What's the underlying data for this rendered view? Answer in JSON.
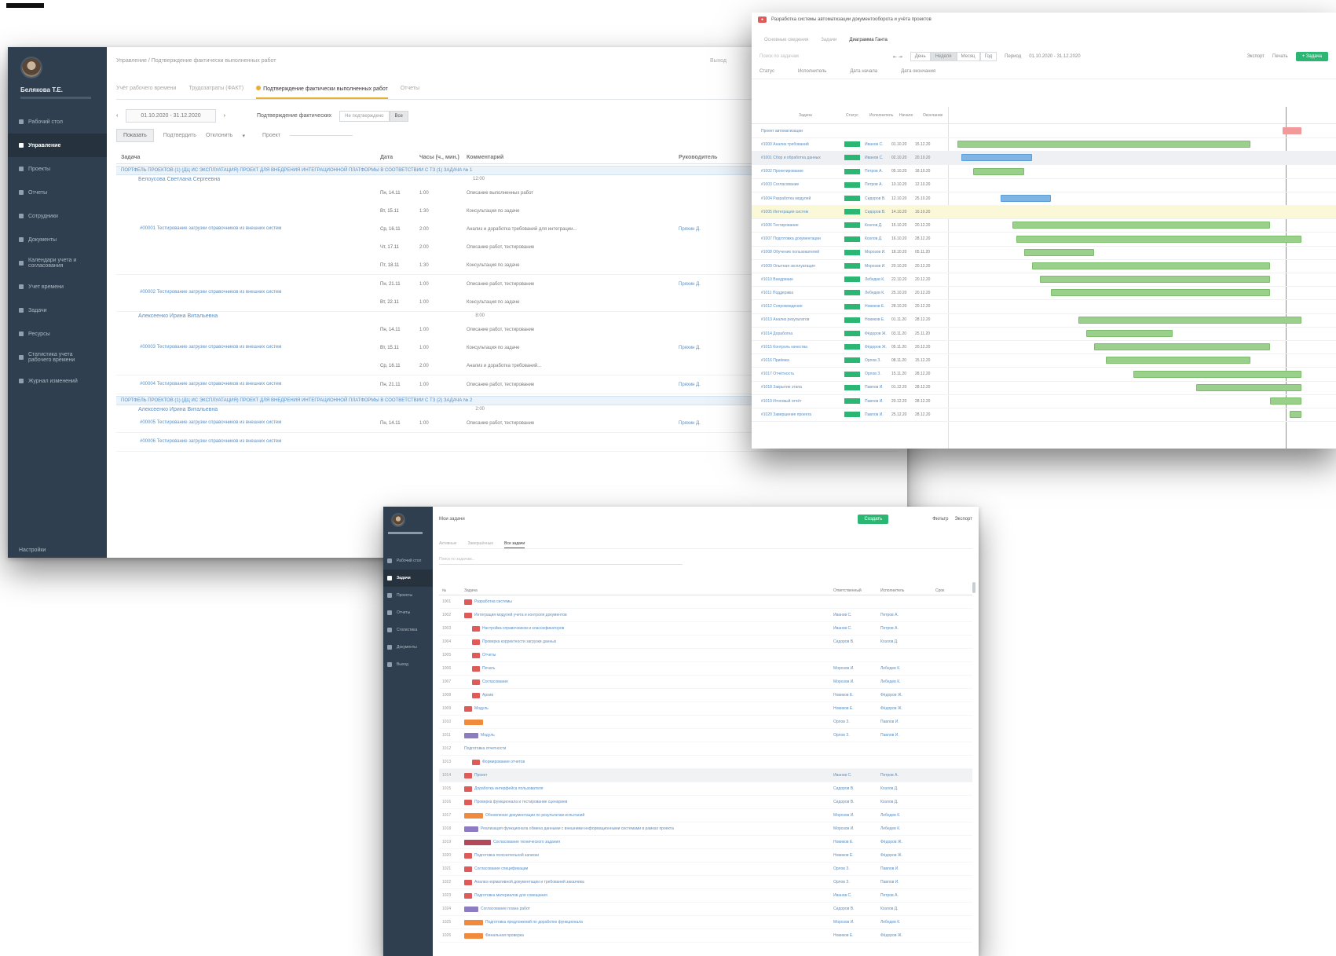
{
  "screen_a": {
    "user": {
      "name": "Белякова Т.Е.",
      "role": ""
    },
    "nav": [
      {
        "label": "Рабочий стол",
        "active": false
      },
      {
        "label": "Управление",
        "active": true
      },
      {
        "label": "Проекты",
        "active": false
      },
      {
        "label": "Отчеты",
        "active": false
      },
      {
        "label": "Сотрудники",
        "active": false
      },
      {
        "label": "Документы",
        "active": false
      },
      {
        "label": "Календари учета и согласования",
        "active": false
      },
      {
        "label": "Учет времени",
        "active": false
      },
      {
        "label": "Задачи",
        "active": false
      },
      {
        "label": "Ресурсы",
        "active": false
      },
      {
        "label": "Статистика учета рабочего времени",
        "active": false
      },
      {
        "label": "Журнал изменений",
        "active": false
      }
    ],
    "nav_bottom": "Настройки",
    "breadcrumb": "Управление / Подтверждение фактически выполненных работ",
    "breadcrumb_right": "Выход",
    "tabs": [
      {
        "label": "Учёт рабочего времени",
        "active": false
      },
      {
        "label": "Трудозатраты (ФАКТ)",
        "active": false
      },
      {
        "label": "Подтверждение фактически выполненных работ",
        "active": true
      },
      {
        "label": "Отчеты",
        "active": false
      }
    ],
    "date_range": "01.10.2020 - 31.12.2020",
    "confirm_label": "Подтверждение фактических",
    "confirm_options": [
      "Не подтверждено",
      "Все"
    ],
    "filter_buttons": [
      "Показать",
      "Подтвердить",
      "Отклонить"
    ],
    "project_label": "Проект",
    "columns": [
      "Задача",
      "Дата",
      "Часы (ч., мин.)",
      "Комментарий",
      "Руководитель"
    ],
    "groups": [
      {
        "title": "ПОРТФЕЛЬ ПРОЕКТОВ (1) (ДЦ ИС ЭКСПЛУАТАЦИЯ) ПРОЕКТ ДЛЯ ВНЕДРЕНИЯ ИНТЕГРАЦИОННОЙ ПЛАТФОРМЫ В СООТВЕТСТВИИ С ТЗ (1) ЗАДАЧА № 1",
        "people": [
          {
            "name": "Белоусова Светлана Сергеевна",
            "hours": "12:00",
            "tasks": [
              {
                "name": "#00001 Тестирование загрузки справочников из внешних систем",
                "assignee": "Пряхин Д.",
                "days": [
                  {
                    "date": "Пн, 14.11",
                    "hours": "1:00",
                    "comment": "Описание выполненных работ"
                  },
                  {
                    "date": "Вт, 15.11",
                    "hours": "1:30",
                    "comment": "Консультация по задаче"
                  },
                  {
                    "date": "Ср, 16.11",
                    "hours": "2:00",
                    "comment": "Анализ и доработка требований для интеграции..."
                  },
                  {
                    "date": "Чт, 17.11",
                    "hours": "2:00",
                    "comment": "Описание работ, тестирование"
                  },
                  {
                    "date": "Пт, 18.11",
                    "hours": "1:30",
                    "comment": "Консультация по задаче"
                  }
                ]
              },
              {
                "name": "#00002 Тестирование загрузки справочников из внешних систем",
                "assignee": "Пряхин Д.",
                "days": [
                  {
                    "date": "Пн, 21.11",
                    "hours": "1:00",
                    "comment": "Описание работ, тестирование"
                  },
                  {
                    "date": "Вт, 22.11",
                    "hours": "1:00",
                    "comment": "Консультация по задаче"
                  }
                ]
              }
            ]
          },
          {
            "name": "Алексеенко Ирина Витальевна",
            "hours": "8:00",
            "tasks": [
              {
                "name": "#00003 Тестирование загрузки справочников из внешних систем",
                "assignee": "Пряхин Д.",
                "days": [
                  {
                    "date": "Пн, 14.11",
                    "hours": "1:00",
                    "comment": "Описание работ, тестирование"
                  },
                  {
                    "date": "Вт, 15.11",
                    "hours": "1:00",
                    "comment": "Консультация по задаче"
                  },
                  {
                    "date": "Ср, 16.11",
                    "hours": "2:00",
                    "comment": "Анализ и доработка требований..."
                  }
                ]
              },
              {
                "name": "#00004 Тестирование загрузки справочников из внешних систем",
                "assignee": "Пряхин Д.",
                "days": [
                  {
                    "date": "Пн, 21.11",
                    "hours": "1:00",
                    "comment": "Описание работ, тестирование"
                  }
                ]
              }
            ]
          }
        ]
      },
      {
        "title": "ПОРТФЕЛЬ ПРОЕКТОВ (1) (ДЦ ИС ЭКСПЛУАТАЦИЯ) ПРОЕКТ ДЛЯ ВНЕДРЕНИЯ ИНТЕГРАЦИОННОЙ ПЛАТФОРМЫ В СООТВЕТСТВИИ С ТЗ (2) ЗАДАЧА № 2",
        "people": [
          {
            "name": "Алексеенко Ирина Витальевна",
            "hours": "2:00",
            "tasks": [
              {
                "name": "#00005 Тестирование загрузки справочников из внешних систем",
                "assignee": "Пряхин Д.",
                "days": [
                  {
                    "date": "Пн, 14.11",
                    "hours": "1:00",
                    "comment": "Описание работ, тестирование"
                  }
                ]
              },
              {
                "name": "#00006 Тестирование загрузки справочников из внешних систем",
                "assignee": "",
                "days": []
              }
            ]
          }
        ]
      }
    ],
    "reject_label": "Отклонить"
  },
  "screen_b": {
    "title": "Разработка системы автоматизации документооборота и учёта проектов",
    "subtabs": [
      "Основные сведения",
      "Задачи",
      "Диаграмма Ганта"
    ],
    "active_subtab": 2,
    "search_placeholder": "Поиск по задачам",
    "scale_options": [
      "День",
      "Неделя",
      "Месяц",
      "Год"
    ],
    "active_scale": 1,
    "period_label": "Период",
    "period_value": "01.10.2020 - 31.12.2020",
    "toolbar_right": [
      "Экспорт",
      "Печать"
    ],
    "add_button": "+ Задача",
    "filter_labels": [
      "Статус",
      "Исполнитель",
      "Дата начала",
      "Дата окончания"
    ],
    "columns": [
      "Задача",
      "Статус",
      "Исполнитель",
      "Начало",
      "Окончание"
    ],
    "rows": [
      {
        "name": "Проект автоматизации",
        "status": "",
        "person": "",
        "start": "",
        "end": "",
        "bar": "red"
      },
      {
        "name": "#1000 Анализ требований",
        "status": "Новая",
        "person": "Иванов С.",
        "start": "01.10.20",
        "end": "15.12.20",
        "bar": "green"
      },
      {
        "name": "#1001 Сбор и обработка данных",
        "status": "Новая",
        "person": "Иванов С.",
        "start": "02.10.20",
        "end": "20.10.20",
        "bar": "blue"
      },
      {
        "name": "#1002 Проектирование",
        "status": "Новая",
        "person": "Петров А.",
        "start": "05.10.20",
        "end": "18.10.20",
        "bar": "green"
      },
      {
        "name": "#1003 Согласование",
        "status": "Новая",
        "person": "Петров А.",
        "start": "10.10.20",
        "end": "12.10.20",
        "bar": ""
      },
      {
        "name": "#1004 Разработка модулей",
        "status": "Новая",
        "person": "Сидоров В.",
        "start": "12.10.20",
        "end": "25.10.20",
        "bar": "blue"
      },
      {
        "name": "#1005 Интеграция систем",
        "status": "Новая",
        "person": "Сидоров В.",
        "start": "14.10.20",
        "end": "16.10.20",
        "bar": ""
      },
      {
        "name": "#1006 Тестирование",
        "status": "Новая",
        "person": "Козлов Д.",
        "start": "15.10.20",
        "end": "20.12.20",
        "bar": "green"
      },
      {
        "name": "#1007 Подготовка документации",
        "status": "Новая",
        "person": "Козлов Д.",
        "start": "16.10.20",
        "end": "28.12.20",
        "bar": "green"
      },
      {
        "name": "#1008 Обучение пользователей",
        "status": "Новая",
        "person": "Морозов И.",
        "start": "18.10.20",
        "end": "05.11.20",
        "bar": "green"
      },
      {
        "name": "#1009 Опытная эксплуатация",
        "status": "Новая",
        "person": "Морозов И.",
        "start": "20.10.20",
        "end": "20.12.20",
        "bar": "green"
      },
      {
        "name": "#1010 Внедрение",
        "status": "Новая",
        "person": "Лебедев К.",
        "start": "22.10.20",
        "end": "20.12.20",
        "bar": "green"
      },
      {
        "name": "#1011 Поддержка",
        "status": "Новая",
        "person": "Лебедев К.",
        "start": "25.10.20",
        "end": "20.12.20",
        "bar": "green"
      },
      {
        "name": "#1012 Сопровождение",
        "status": "Новая",
        "person": "Новиков Е.",
        "start": "28.10.20",
        "end": "20.12.20",
        "bar": ""
      },
      {
        "name": "#1013 Анализ результатов",
        "status": "Новая",
        "person": "Новиков Е.",
        "start": "01.11.20",
        "end": "28.12.20",
        "bar": "green"
      },
      {
        "name": "#1014 Доработка",
        "status": "Новая",
        "person": "Фёдоров Ж.",
        "start": "03.11.20",
        "end": "25.11.20",
        "bar": "green"
      },
      {
        "name": "#1015 Контроль качества",
        "status": "Новая",
        "person": "Фёдоров Ж.",
        "start": "05.11.20",
        "end": "20.12.20",
        "bar": "green"
      },
      {
        "name": "#1016 Приёмка",
        "status": "Новая",
        "person": "Орлов З.",
        "start": "08.11.20",
        "end": "15.12.20",
        "bar": "green"
      },
      {
        "name": "#1017 Отчётность",
        "status": "Новая",
        "person": "Орлов З.",
        "start": "15.11.20",
        "end": "28.12.20",
        "bar": "green"
      },
      {
        "name": "#1018 Закрытие этапа",
        "status": "Новая",
        "person": "Павлов И.",
        "start": "01.12.20",
        "end": "28.12.20",
        "bar": "green"
      },
      {
        "name": "#1019 Итоговый отчёт",
        "status": "Новая",
        "person": "Павлов И.",
        "start": "20.12.20",
        "end": "28.12.20",
        "bar": "green"
      },
      {
        "name": "#1020 Завершение проекта",
        "status": "Новая",
        "person": "Павлов И.",
        "start": "25.12.20",
        "end": "28.12.20",
        "bar": "green"
      }
    ]
  },
  "screen_c": {
    "nav": [
      {
        "label": "Рабочий стол",
        "active": false
      },
      {
        "label": "Задачи",
        "active": true
      },
      {
        "label": "Проекты",
        "active": false
      },
      {
        "label": "Отчеты",
        "active": false
      },
      {
        "label": "Статистика",
        "active": false
      },
      {
        "label": "Документы",
        "active": false
      },
      {
        "label": "Выход",
        "active": false
      }
    ],
    "title": "Мои задачи",
    "create_button": "Создать",
    "header_right": [
      "Фильтр",
      "Экспорт"
    ],
    "subtabs": [
      "Активные",
      "Завершённые",
      "Все задачи"
    ],
    "active_subtab": 2,
    "search_placeholder": "Поиск по задачам...",
    "columns": [
      "№",
      "Задача",
      "Ответственный",
      "Исполнитель",
      "Срок"
    ],
    "rows": [
      {
        "id": "1001",
        "title": "Разработка системы",
        "tag": "red",
        "indent": 0,
        "owner": "",
        "executor": ""
      },
      {
        "id": "1002",
        "title": "Интеграция модулей учета и контроля документов",
        "tag": "red",
        "indent": 0,
        "owner": "Иванов С.",
        "executor": "Петров А."
      },
      {
        "id": "1003",
        "title": "Настройка справочников и классификаторов",
        "tag": "red",
        "indent": 1,
        "owner": "Иванов С.",
        "executor": "Петров А."
      },
      {
        "id": "1004",
        "title": "Проверка корректности загрузки данных",
        "tag": "red",
        "indent": 1,
        "owner": "Сидоров В.",
        "executor": "Козлов Д."
      },
      {
        "id": "1005",
        "title": "Отчеты",
        "tag": "red",
        "indent": 1,
        "owner": "",
        "executor": ""
      },
      {
        "id": "1006",
        "title": "Печать",
        "tag": "red",
        "indent": 1,
        "owner": "Морозов И.",
        "executor": "Лебедев К."
      },
      {
        "id": "1007",
        "title": "Согласование",
        "tag": "red",
        "indent": 1,
        "owner": "Морозов И.",
        "executor": "Лебедев К."
      },
      {
        "id": "1008",
        "title": "Архив",
        "tag": "red",
        "indent": 1,
        "owner": "Новиков Е.",
        "executor": "Фёдоров Ж."
      },
      {
        "id": "1009",
        "title": "Модуль",
        "tag": "red",
        "indent": 0,
        "owner": "Новиков Е.",
        "executor": "Фёдоров Ж."
      },
      {
        "id": "1010",
        "title": "",
        "tag": "orange",
        "indent": 0,
        "owner": "Орлов З.",
        "executor": "Павлов И."
      },
      {
        "id": "1011",
        "title": "Модуль",
        "tag": "purple",
        "indent": 0,
        "owner": "Орлов З.",
        "executor": "Павлов И."
      },
      {
        "id": "1012",
        "title": "Подготовка отчетности",
        "tag": "",
        "indent": 0,
        "owner": "",
        "executor": ""
      },
      {
        "id": "1013",
        "title": "Формирование отчетов",
        "tag": "red",
        "indent": 1,
        "owner": "",
        "executor": ""
      },
      {
        "id": "1014",
        "title": "Проект",
        "tag": "red",
        "indent": 0,
        "owner": "Иванов С.",
        "executor": "Петров А."
      },
      {
        "id": "1015",
        "title": "Доработка интерфейса пользователя",
        "tag": "red",
        "indent": 0,
        "owner": "Сидоров В.",
        "executor": "Козлов Д."
      },
      {
        "id": "1016",
        "title": "Проверка функционала и тестирование сценариев",
        "tag": "red",
        "indent": 0,
        "owner": "Сидоров В.",
        "executor": "Козлов Д."
      },
      {
        "id": "1017",
        "title": "Обновление документации по результатам испытаний",
        "tag": "orange",
        "indent": 0,
        "owner": "Морозов И.",
        "executor": "Лебедев К."
      },
      {
        "id": "1018",
        "title": "Реализация функционала обмена данными с внешними информационными системами в рамках проекта",
        "tag": "purple",
        "indent": 0,
        "owner": "Морозов И.",
        "executor": "Лебедев К."
      },
      {
        "id": "1019",
        "title": "Согласование технического задания",
        "tag": "wine",
        "indent": 0,
        "owner": "Новиков Е.",
        "executor": "Фёдоров Ж."
      },
      {
        "id": "1020",
        "title": "Подготовка пояснительной записки",
        "tag": "red",
        "indent": 0,
        "owner": "Новиков Е.",
        "executor": "Фёдоров Ж."
      },
      {
        "id": "1021",
        "title": "Согласование спецификации",
        "tag": "red",
        "indent": 0,
        "owner": "Орлов З.",
        "executor": "Павлов И."
      },
      {
        "id": "1022",
        "title": "Анализ нормативной документации и требований заказчика",
        "tag": "red",
        "indent": 0,
        "owner": "Орлов З.",
        "executor": "Павлов И."
      },
      {
        "id": "1023",
        "title": "Подготовка материалов для совещания",
        "tag": "red",
        "indent": 0,
        "owner": "Иванов С.",
        "executor": "Петров А."
      },
      {
        "id": "1024",
        "title": "Согласование плана работ",
        "tag": "purple",
        "indent": 0,
        "owner": "Сидоров В.",
        "executor": "Козлов Д."
      },
      {
        "id": "1025",
        "title": "Подготовка предложений по доработке функционала",
        "tag": "orange",
        "indent": 0,
        "owner": "Морозов И.",
        "executor": "Лебедев К."
      },
      {
        "id": "1026",
        "title": "Финальная проверка",
        "tag": "orange",
        "indent": 0,
        "owner": "Новиков Е.",
        "executor": "Фёдоров Ж."
      }
    ]
  }
}
